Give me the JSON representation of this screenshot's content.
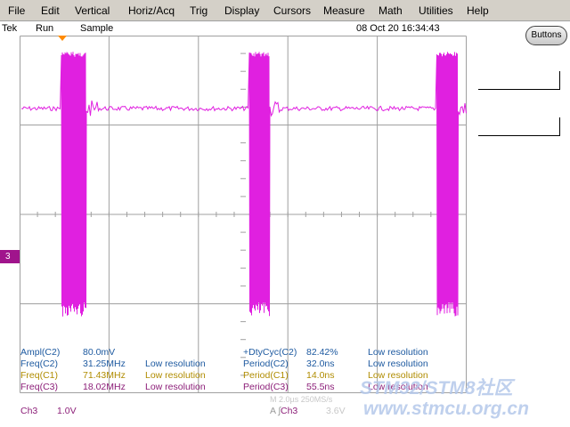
{
  "menu": [
    "File",
    "Edit",
    "Vertical",
    "Horiz/Acq",
    "Trig",
    "Display",
    "Cursors",
    "Measure",
    "Math",
    "Utilities",
    "Help"
  ],
  "status": {
    "brand": "Tek",
    "state": "Run",
    "mode": "Sample",
    "datetime": "08 Oct 20 16:34:43"
  },
  "buttons_label": "Buttons",
  "channel_marker": "3",
  "measurements_left": [
    {
      "label": "Ampl(C2)",
      "value": "80.0mV",
      "note": ""
    },
    {
      "label": "Freq(C2)",
      "value": "31.25MHz",
      "note": "Low resolution"
    },
    {
      "label": "Freq(C1)",
      "value": "71.43MHz",
      "note": "Low resolution"
    },
    {
      "label": "Freq(C3)",
      "value": "18.02MHz",
      "note": "Low resolution"
    }
  ],
  "measurements_right": [
    {
      "label": "+DtyCyc(C2)",
      "value": "82.42%",
      "note": "Low resolution"
    },
    {
      "label": "Period(C2)",
      "value": "32.0ns",
      "note": "Low resolution"
    },
    {
      "label": "Period(C1)",
      "value": "14.0ns",
      "note": "Low resolution"
    },
    {
      "label": "Period(C3)",
      "value": "55.5ns",
      "note": "Low resolution"
    }
  ],
  "bottom": {
    "channel": "Ch3",
    "scale": "1.0V",
    "timebase": "M 2.0µs 250MS/s",
    "trigger_channel": "Ch3",
    "trigger_level": "3.6V"
  },
  "watermark": {
    "line1": "STM32/STM8社区",
    "line2": "www.stmcu.org.cn"
  },
  "colors": {
    "trace": "#e020e0",
    "grid": "#a0a0a0",
    "marker": "#a0148c",
    "menu_bg": "#d4d0c8"
  }
}
